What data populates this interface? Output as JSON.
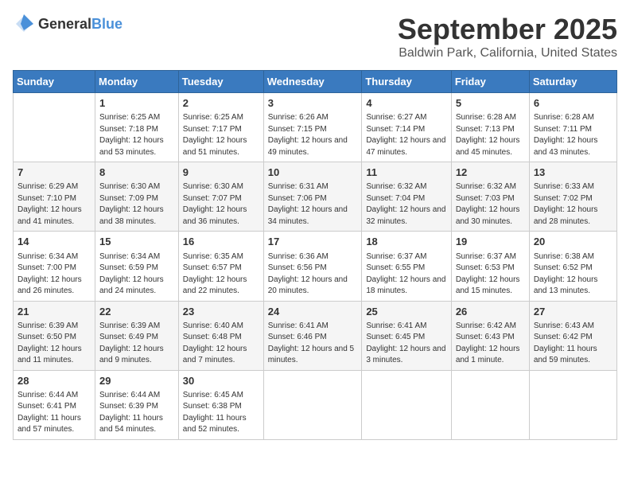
{
  "header": {
    "logo_general": "General",
    "logo_blue": "Blue",
    "month_title": "September 2025",
    "location": "Baldwin Park, California, United States"
  },
  "days_of_week": [
    "Sunday",
    "Monday",
    "Tuesday",
    "Wednesday",
    "Thursday",
    "Friday",
    "Saturday"
  ],
  "weeks": [
    [
      {
        "day": "",
        "info": ""
      },
      {
        "day": "1",
        "info": "Sunrise: 6:25 AM\nSunset: 7:18 PM\nDaylight: 12 hours\nand 53 minutes."
      },
      {
        "day": "2",
        "info": "Sunrise: 6:25 AM\nSunset: 7:17 PM\nDaylight: 12 hours\nand 51 minutes."
      },
      {
        "day": "3",
        "info": "Sunrise: 6:26 AM\nSunset: 7:15 PM\nDaylight: 12 hours\nand 49 minutes."
      },
      {
        "day": "4",
        "info": "Sunrise: 6:27 AM\nSunset: 7:14 PM\nDaylight: 12 hours\nand 47 minutes."
      },
      {
        "day": "5",
        "info": "Sunrise: 6:28 AM\nSunset: 7:13 PM\nDaylight: 12 hours\nand 45 minutes."
      },
      {
        "day": "6",
        "info": "Sunrise: 6:28 AM\nSunset: 7:11 PM\nDaylight: 12 hours\nand 43 minutes."
      }
    ],
    [
      {
        "day": "7",
        "info": "Sunrise: 6:29 AM\nSunset: 7:10 PM\nDaylight: 12 hours\nand 41 minutes."
      },
      {
        "day": "8",
        "info": "Sunrise: 6:30 AM\nSunset: 7:09 PM\nDaylight: 12 hours\nand 38 minutes."
      },
      {
        "day": "9",
        "info": "Sunrise: 6:30 AM\nSunset: 7:07 PM\nDaylight: 12 hours\nand 36 minutes."
      },
      {
        "day": "10",
        "info": "Sunrise: 6:31 AM\nSunset: 7:06 PM\nDaylight: 12 hours\nand 34 minutes."
      },
      {
        "day": "11",
        "info": "Sunrise: 6:32 AM\nSunset: 7:04 PM\nDaylight: 12 hours\nand 32 minutes."
      },
      {
        "day": "12",
        "info": "Sunrise: 6:32 AM\nSunset: 7:03 PM\nDaylight: 12 hours\nand 30 minutes."
      },
      {
        "day": "13",
        "info": "Sunrise: 6:33 AM\nSunset: 7:02 PM\nDaylight: 12 hours\nand 28 minutes."
      }
    ],
    [
      {
        "day": "14",
        "info": "Sunrise: 6:34 AM\nSunset: 7:00 PM\nDaylight: 12 hours\nand 26 minutes."
      },
      {
        "day": "15",
        "info": "Sunrise: 6:34 AM\nSunset: 6:59 PM\nDaylight: 12 hours\nand 24 minutes."
      },
      {
        "day": "16",
        "info": "Sunrise: 6:35 AM\nSunset: 6:57 PM\nDaylight: 12 hours\nand 22 minutes."
      },
      {
        "day": "17",
        "info": "Sunrise: 6:36 AM\nSunset: 6:56 PM\nDaylight: 12 hours\nand 20 minutes."
      },
      {
        "day": "18",
        "info": "Sunrise: 6:37 AM\nSunset: 6:55 PM\nDaylight: 12 hours\nand 18 minutes."
      },
      {
        "day": "19",
        "info": "Sunrise: 6:37 AM\nSunset: 6:53 PM\nDaylight: 12 hours\nand 15 minutes."
      },
      {
        "day": "20",
        "info": "Sunrise: 6:38 AM\nSunset: 6:52 PM\nDaylight: 12 hours\nand 13 minutes."
      }
    ],
    [
      {
        "day": "21",
        "info": "Sunrise: 6:39 AM\nSunset: 6:50 PM\nDaylight: 12 hours\nand 11 minutes."
      },
      {
        "day": "22",
        "info": "Sunrise: 6:39 AM\nSunset: 6:49 PM\nDaylight: 12 hours\nand 9 minutes."
      },
      {
        "day": "23",
        "info": "Sunrise: 6:40 AM\nSunset: 6:48 PM\nDaylight: 12 hours\nand 7 minutes."
      },
      {
        "day": "24",
        "info": "Sunrise: 6:41 AM\nSunset: 6:46 PM\nDaylight: 12 hours\nand 5 minutes."
      },
      {
        "day": "25",
        "info": "Sunrise: 6:41 AM\nSunset: 6:45 PM\nDaylight: 12 hours\nand 3 minutes."
      },
      {
        "day": "26",
        "info": "Sunrise: 6:42 AM\nSunset: 6:43 PM\nDaylight: 12 hours\nand 1 minute."
      },
      {
        "day": "27",
        "info": "Sunrise: 6:43 AM\nSunset: 6:42 PM\nDaylight: 11 hours\nand 59 minutes."
      }
    ],
    [
      {
        "day": "28",
        "info": "Sunrise: 6:44 AM\nSunset: 6:41 PM\nDaylight: 11 hours\nand 57 minutes."
      },
      {
        "day": "29",
        "info": "Sunrise: 6:44 AM\nSunset: 6:39 PM\nDaylight: 11 hours\nand 54 minutes."
      },
      {
        "day": "30",
        "info": "Sunrise: 6:45 AM\nSunset: 6:38 PM\nDaylight: 11 hours\nand 52 minutes."
      },
      {
        "day": "",
        "info": ""
      },
      {
        "day": "",
        "info": ""
      },
      {
        "day": "",
        "info": ""
      },
      {
        "day": "",
        "info": ""
      }
    ]
  ]
}
